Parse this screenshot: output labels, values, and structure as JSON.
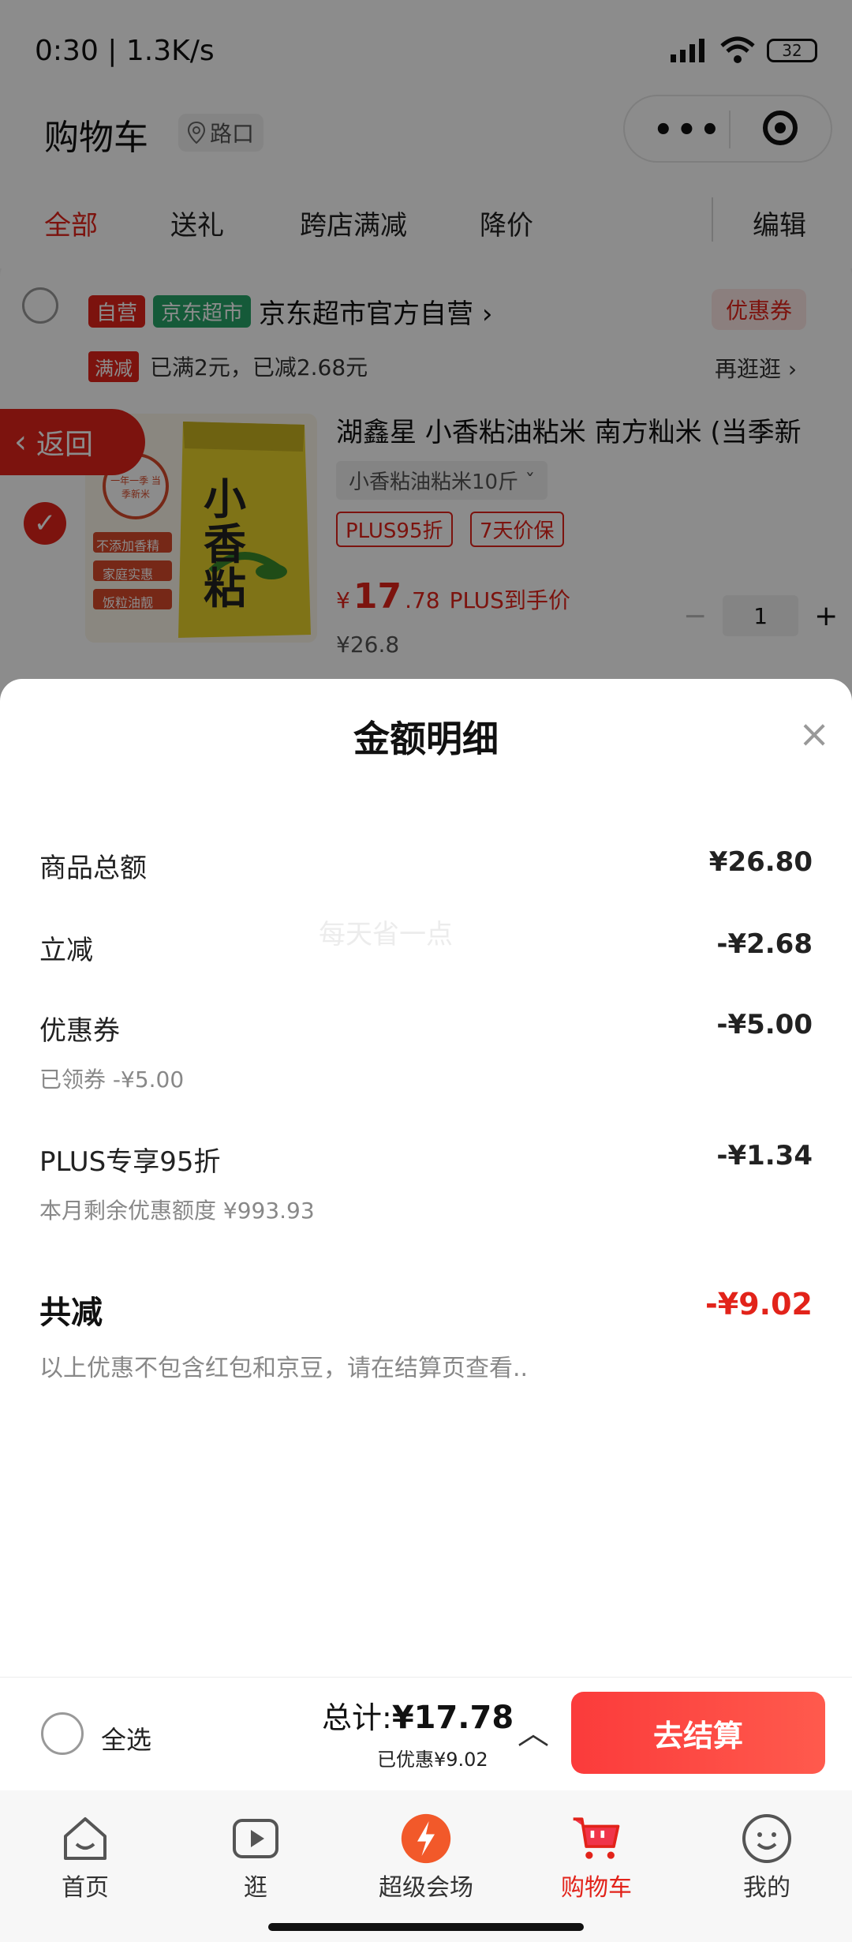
{
  "status_bar": {
    "time": "0:30 | 1.3K/s",
    "battery": "32"
  },
  "header": {
    "title": "购物车",
    "location": "路口"
  },
  "tabs": [
    {
      "label": "全部",
      "active": true
    },
    {
      "label": "送礼",
      "active": false
    },
    {
      "label": "跨店满减",
      "active": false
    },
    {
      "label": "降价",
      "active": false
    }
  ],
  "edit_label": "编辑",
  "shop": {
    "badge_self": "自营",
    "badge_market": "京东超市",
    "name": "京东超市官方自营 ›",
    "coupon_tag": "优惠券",
    "fullcut_mark": "满减",
    "fullcut_text": "已满2元，已减2.68元",
    "browse_more": "再逛逛 ›"
  },
  "back_label": "返回",
  "product": {
    "title": "湖鑫星 小香粘油粘米 南方籼米 (当季新",
    "spec": "小香粘油粘米10斤",
    "tag_plus": "PLUS95折",
    "tag_price_protect": "7天价保",
    "price_currency": "¥",
    "price_int": "17",
    "price_dec": ".78",
    "price_note": "PLUS到手价",
    "original_price": "¥26.8",
    "quantity": "1",
    "image_labels": {
      "brand_chars": "小香粘",
      "seal": "一年一季 当季新米",
      "b1": "不添加香精",
      "b2": "家庭实惠",
      "b3": "饭粒油靓"
    }
  },
  "sheet": {
    "title": "金额明细",
    "watermark": "每天省一点",
    "rows": [
      {
        "label": "商品总额",
        "value": "¥26.80"
      },
      {
        "label": "立减",
        "value": "-¥2.68"
      },
      {
        "label": "优惠券",
        "value": "-¥5.00",
        "sub": "已领券 -¥5.00"
      },
      {
        "label": "PLUS专享95折",
        "value": "-¥1.34",
        "sub": "本月剩余优惠额度 ¥993.93"
      }
    ],
    "total_label": "共减",
    "total_value": "-¥9.02",
    "note": "以上优惠不包含红包和京豆，请在结算页查看.."
  },
  "checkout": {
    "select_all": "全选",
    "total_prefix": "总计:",
    "total_value": "¥17.78",
    "saved": "已优惠¥9.02",
    "pay_button": "去结算"
  },
  "nav": [
    {
      "label": "首页",
      "icon": "home-icon"
    },
    {
      "label": "逛",
      "icon": "play-icon"
    },
    {
      "label": "超级会场",
      "icon": "venue-icon"
    },
    {
      "label": "购物车",
      "icon": "cart-icon",
      "active": true
    },
    {
      "label": "我的",
      "icon": "profile-icon"
    }
  ],
  "colors": {
    "accent": "#e2231a",
    "green": "#27a568"
  }
}
